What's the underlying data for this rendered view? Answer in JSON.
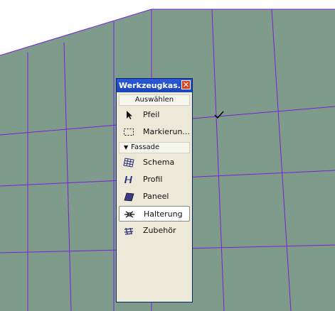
{
  "palette": {
    "title": "Werkzeugkas...",
    "close_glyph": "✕",
    "sections": [
      {
        "label": "Auswählen",
        "tools": [
          {
            "label": "Pfeil",
            "icon": "arrow-pointer-icon"
          },
          {
            "label": "Markierun...",
            "icon": "marquee-selection-icon"
          }
        ]
      },
      {
        "label": "Fassade",
        "collapsed_indicator": "▼",
        "tools": [
          {
            "label": "Schema",
            "icon": "grid-scheme-icon"
          },
          {
            "label": "Profil",
            "icon": "profile-icon"
          },
          {
            "label": "Paneel",
            "icon": "panel-icon"
          },
          {
            "label": "Halterung",
            "icon": "bracket-icon",
            "selected": true
          },
          {
            "label": "Zubehör",
            "icon": "accessory-icon"
          }
        ]
      }
    ]
  },
  "colors": {
    "facade_surface": "#7f9b8c",
    "grid_line": "#7a20d8",
    "titlebar": "#1f4fc8",
    "close_button": "#d8431e"
  }
}
